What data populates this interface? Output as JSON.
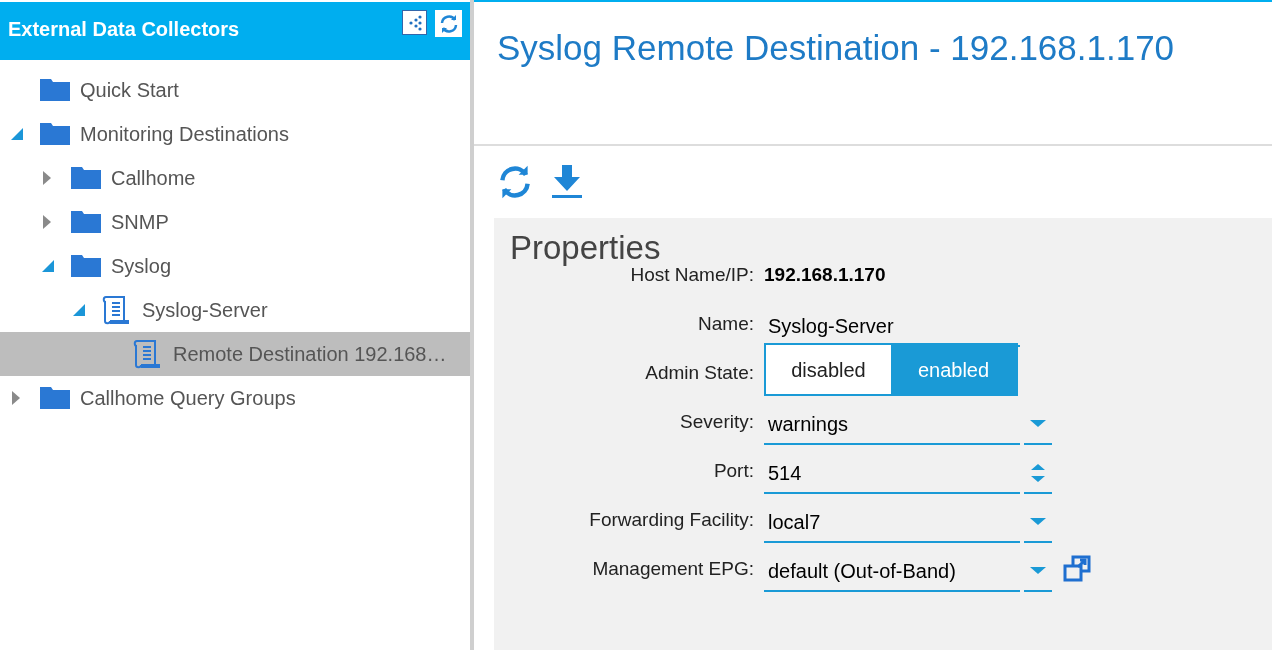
{
  "sidebar": {
    "title": "External Data Collectors",
    "tree": [
      {
        "label": "Quick Start",
        "kind": "folder",
        "selected": false
      },
      {
        "label": "Monitoring Destinations",
        "kind": "folder",
        "expanded": true,
        "selected": false,
        "children": [
          {
            "label": "Callhome",
            "kind": "folder",
            "expanded": false,
            "selected": false
          },
          {
            "label": "SNMP",
            "kind": "folder",
            "expanded": false,
            "selected": false
          },
          {
            "label": "Syslog",
            "kind": "folder",
            "expanded": true,
            "selected": false,
            "children": [
              {
                "label": "Syslog-Server",
                "kind": "document",
                "expanded": true,
                "selected": false,
                "children": [
                  {
                    "label": "Remote Destination 192.168…",
                    "kind": "document",
                    "selected": true
                  }
                ]
              }
            ]
          }
        ]
      },
      {
        "label": "Callhome Query Groups",
        "kind": "folder",
        "expanded": false,
        "selected": false
      }
    ]
  },
  "main": {
    "title": "Syslog Remote Destination - 192.168.1.170",
    "properties": {
      "title": "Properties",
      "fields": [
        {
          "kind": "static",
          "label": "Host Name/IP:",
          "value": "192.168.1.170"
        },
        {
          "kind": "text",
          "label": "Name:",
          "value": "Syslog-Server"
        },
        {
          "kind": "toggle",
          "label": "Admin State:",
          "options": [
            {
              "label": "disabled",
              "selected": false
            },
            {
              "label": "enabled",
              "selected": true
            }
          ]
        },
        {
          "kind": "select",
          "label": "Severity:",
          "value": "warnings"
        },
        {
          "kind": "number",
          "label": "Port:",
          "value": "514"
        },
        {
          "kind": "select",
          "label": "Forwarding Facility:",
          "value": "local7"
        },
        {
          "kind": "select_link",
          "label": "Management EPG:",
          "value": "default (Out-of-Band)"
        }
      ]
    }
  }
}
